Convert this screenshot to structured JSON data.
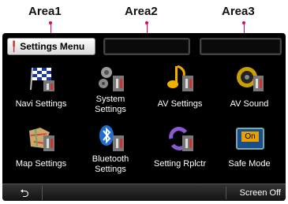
{
  "areas": [
    {
      "label": "Area1"
    },
    {
      "label": "Area2"
    },
    {
      "label": "Area3"
    }
  ],
  "header": {
    "title": "Settings Menu",
    "title_icon": "settings-tool-icon"
  },
  "tiles": [
    {
      "label": "Navi Settings",
      "icon": "navi-flag-icon"
    },
    {
      "label": "System Settings",
      "line1": "System",
      "line2": "Settings",
      "icon": "system-gears-icon"
    },
    {
      "label": "AV Settings",
      "icon": "music-note-icon"
    },
    {
      "label": "AV Sound",
      "icon": "speaker-icon"
    },
    {
      "label": "Map Settings",
      "icon": "map-icon"
    },
    {
      "label": "Bluetooth Settings",
      "line1": "Bluetooth",
      "line2": "Settings",
      "icon": "bluetooth-icon"
    },
    {
      "label": "Setting Rplctr",
      "icon": "replicator-arrows-icon"
    },
    {
      "label": "Safe Mode",
      "badge": "On",
      "icon": "safe-mode-icon"
    }
  ],
  "footer": {
    "back_icon": "back-arrow-icon",
    "back_glyph": "⮌",
    "screen_off": "Screen Off"
  },
  "colors": {
    "leader": "#e0006e",
    "background": "#000000",
    "text": "#ffffff"
  }
}
